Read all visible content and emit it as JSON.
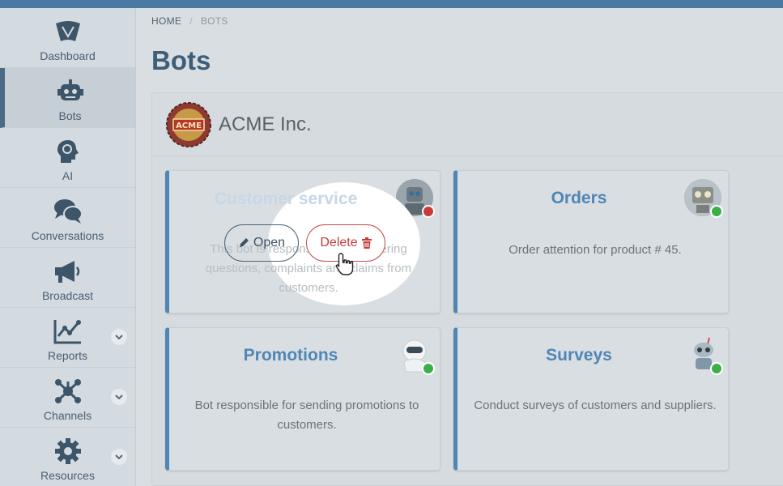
{
  "breadcrumb": {
    "home": "HOME",
    "separator": "/",
    "current": "BOTS"
  },
  "page": {
    "title": "Bots"
  },
  "sidebar": {
    "items": [
      {
        "label": "Dashboard",
        "icon": "dashboard-icon",
        "active": false
      },
      {
        "label": "Bots",
        "icon": "robot-icon",
        "active": true
      },
      {
        "label": "AI",
        "icon": "brain-head-icon",
        "active": false
      },
      {
        "label": "Conversations",
        "icon": "chat-bubbles-icon",
        "active": false
      },
      {
        "label": "Broadcast",
        "icon": "megaphone-icon",
        "active": false
      },
      {
        "label": "Reports",
        "icon": "line-chart-icon",
        "active": false,
        "expandable": true
      },
      {
        "label": "Channels",
        "icon": "network-icon",
        "active": false,
        "expandable": true
      },
      {
        "label": "Resources",
        "icon": "gear-icon",
        "active": false,
        "expandable": true
      }
    ]
  },
  "company": {
    "name": "ACME Inc.",
    "logo_text": "ACME"
  },
  "bots": [
    {
      "name": "Customer service",
      "description": "This bot is responsible for answering questions, complaints and claims from customers.",
      "status": "offline"
    },
    {
      "name": "Orders",
      "description": "Order attention for product # 45.",
      "status": "online"
    },
    {
      "name": "Promotions",
      "description": "Bot responsible for sending promotions to customers.",
      "status": "online"
    },
    {
      "name": "Surveys",
      "description": "Conduct surveys of customers and suppliers.",
      "status": "online"
    }
  ],
  "actions": {
    "open_label": "Open",
    "delete_label": "Delete"
  },
  "colors": {
    "accent": "#4f86b6",
    "danger": "#c43b3b",
    "online": "#3daf48",
    "offline": "#c93a3a",
    "topbar": "#4a7aa3"
  }
}
